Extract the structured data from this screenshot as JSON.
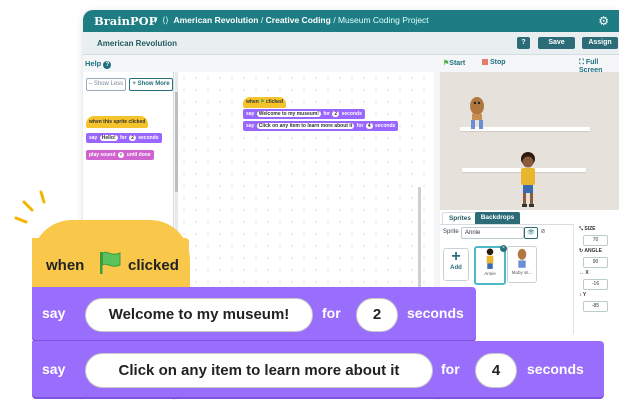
{
  "app": {
    "brand": "BrainPOP",
    "crumb_sep": "/",
    "crumb_topic": "American Revolution",
    "crumb_tool": "Creative Coding",
    "crumb_project": "Museum Coding Project"
  },
  "subbar": {
    "title": "American Revolution",
    "help_q": "?",
    "save": "Save",
    "assign": "Assign"
  },
  "toolbar": {
    "help": "Help",
    "start": "Start",
    "stop": "Stop",
    "fullscreen": "Full Screen"
  },
  "palette": {
    "show_less": "– Show Less",
    "show_more": "+ Show More",
    "block_when": "when this sprite clicked",
    "block_say": "say",
    "block_say_text": "Hello!",
    "block_say_for": "for",
    "block_say_secs": "2",
    "block_say_seconds": "seconds",
    "block_play": "play sound",
    "block_play_until": "until done"
  },
  "script": {
    "when": "when",
    "clicked": "clicked",
    "say": "say",
    "msg1": "Welcome to my museum!",
    "for": "for",
    "secs1": "2",
    "seconds": "seconds",
    "msg2": "Click on any item to learn more about it",
    "secs2": "4"
  },
  "sprites": {
    "tab_sprites": "Sprites",
    "tab_backdrops": "Backdrops",
    "name_label": "Sprite",
    "name_value": "Annie",
    "add": "Add",
    "items": [
      "Annie",
      "Moby sit..."
    ],
    "size_label": "SIZE",
    "size": "70",
    "angle_label": "ANGLE",
    "angle": "90",
    "x_label": "X",
    "x": "-16",
    "y_label": "Y",
    "y": "-85"
  },
  "colors": {
    "teal": "#1e7d83",
    "event_yellow": "#f9c84a",
    "looks_purple": "#9a6efc",
    "button": "#2b6c78"
  }
}
